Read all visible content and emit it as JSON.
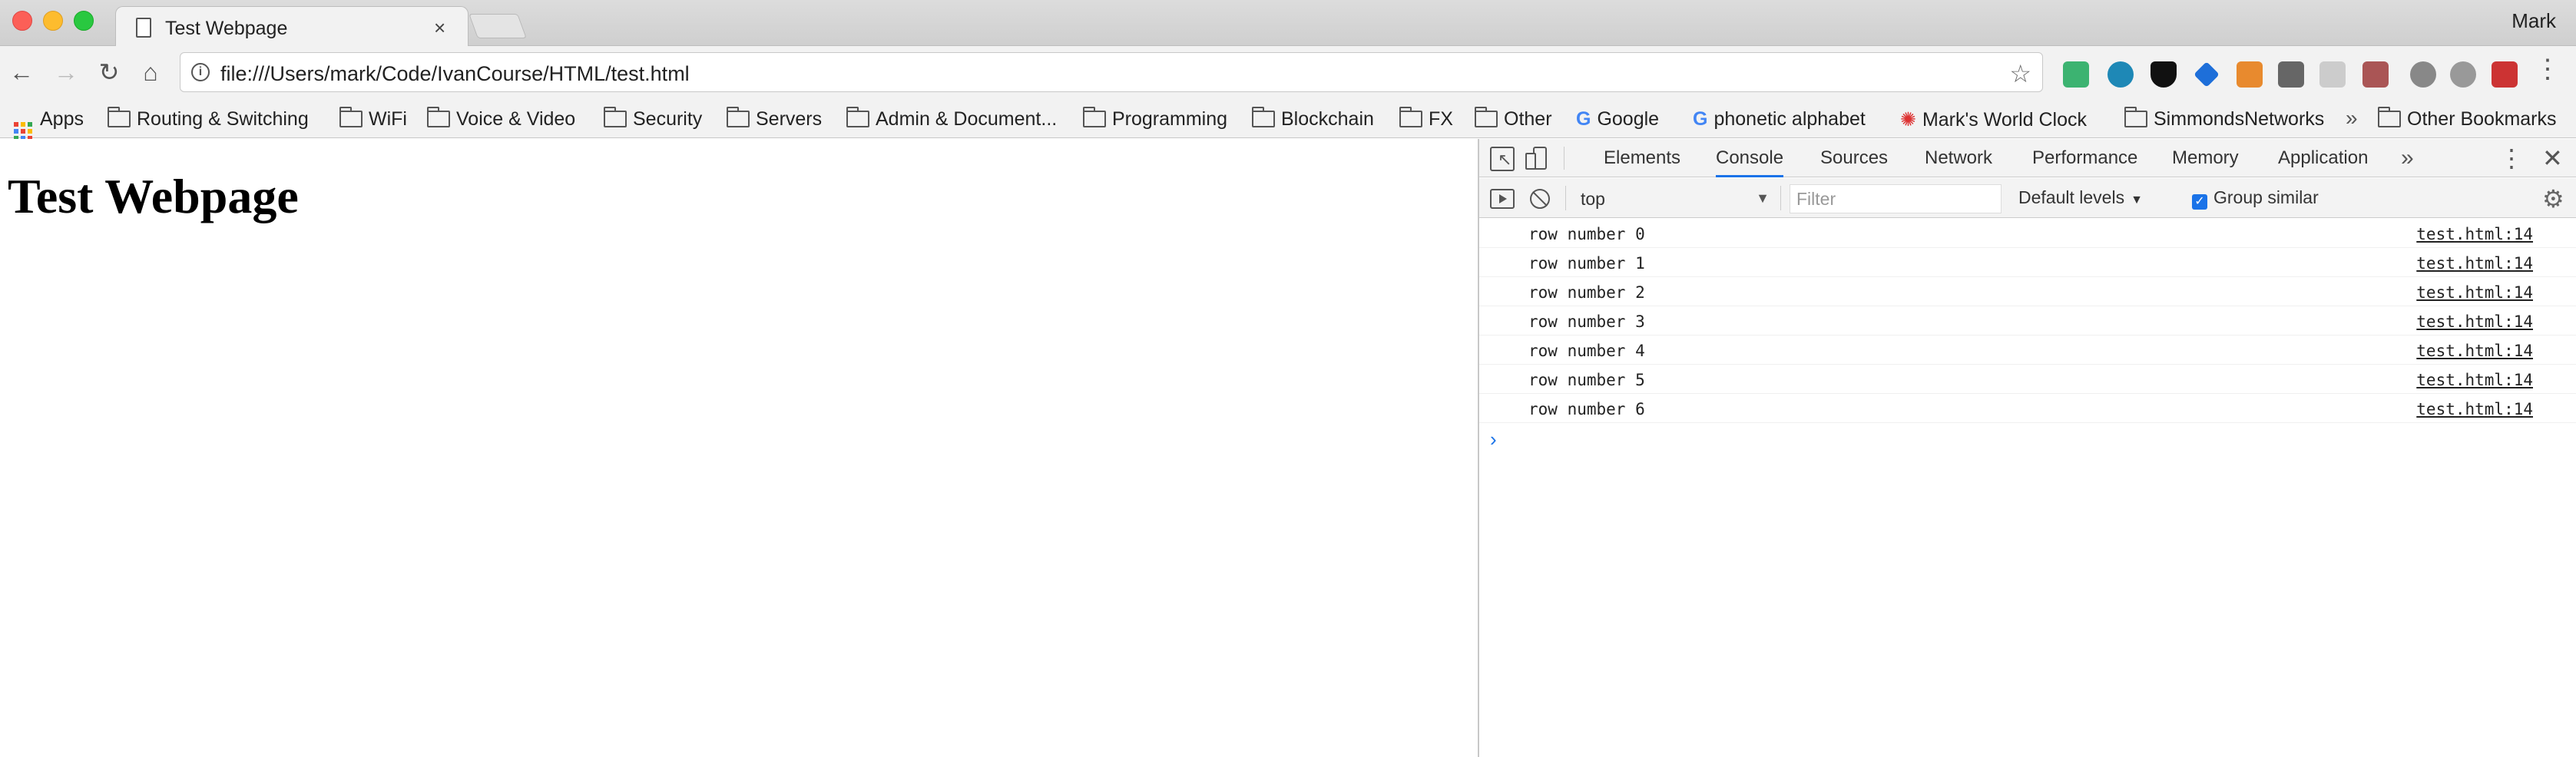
{
  "browser": {
    "tab_title": "Test Webpage",
    "tab_close": "×",
    "profile_name": "Mark",
    "url": "file:///Users/mark/Code/IvanCourse/HTML/test.html"
  },
  "bookmarks": [
    {
      "label": "Apps",
      "icon": "apps-grid-icon"
    },
    {
      "label": "Routing & Switching",
      "icon": "folder-icon"
    },
    {
      "label": "WiFi",
      "icon": "folder-icon"
    },
    {
      "label": "Voice & Video",
      "icon": "folder-icon"
    },
    {
      "label": "Security",
      "icon": "folder-icon"
    },
    {
      "label": "Servers",
      "icon": "folder-icon"
    },
    {
      "label": "Admin & Document...",
      "icon": "folder-icon"
    },
    {
      "label": "Programming",
      "icon": "folder-icon"
    },
    {
      "label": "Blockchain",
      "icon": "folder-icon"
    },
    {
      "label": "FX",
      "icon": "folder-icon"
    },
    {
      "label": "Other",
      "icon": "folder-icon"
    },
    {
      "label": "Google",
      "icon": "google-icon"
    },
    {
      "label": "phonetic alphabet",
      "icon": "google-icon"
    },
    {
      "label": "Mark's World Clock",
      "icon": "clock-icon"
    },
    {
      "label": "SimmondsNetworks",
      "icon": "folder-icon"
    },
    {
      "label": "Other Bookmarks",
      "icon": "folder-icon"
    }
  ],
  "bookmarks_overflow": "»",
  "page": {
    "heading": "Test Webpage"
  },
  "devtools": {
    "tabs": [
      "Elements",
      "Console",
      "Sources",
      "Network",
      "Performance",
      "Memory",
      "Application"
    ],
    "active_tab": "Console",
    "more_tabs": "»",
    "context": "top",
    "filter_placeholder": "Filter",
    "levels": "Default levels",
    "group_similar": "Group similar",
    "group_similar_checked": true,
    "logs": [
      {
        "message": "row number 0",
        "source": "test.html:14"
      },
      {
        "message": "row number 1",
        "source": "test.html:14"
      },
      {
        "message": "row number 2",
        "source": "test.html:14"
      },
      {
        "message": "row number 3",
        "source": "test.html:14"
      },
      {
        "message": "row number 4",
        "source": "test.html:14"
      },
      {
        "message": "row number 5",
        "source": "test.html:14"
      },
      {
        "message": "row number 6",
        "source": "test.html:14"
      }
    ],
    "prompt": "›"
  },
  "colors": {
    "accent": "#1a73e8",
    "close": "#fc5f57",
    "minimize": "#fdbc2e",
    "maximize": "#29c840"
  }
}
